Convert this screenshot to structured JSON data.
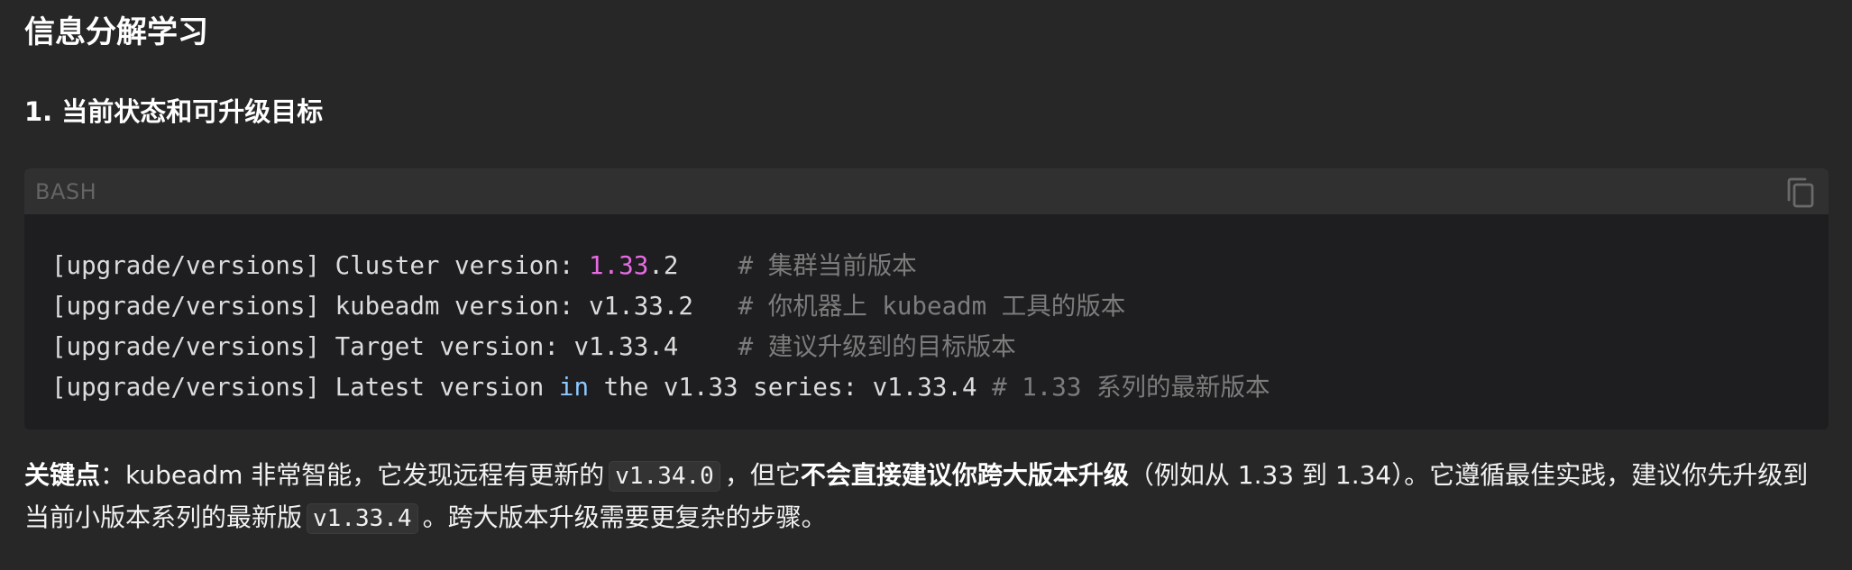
{
  "article": {
    "title": "信息分解学习",
    "section_heading": "1. 当前状态和可升级目标"
  },
  "code_block": {
    "language": "BASH",
    "copy_icon": "copy-icon",
    "lines": [
      {
        "prefix": "[upgrade/versions] Cluster version: ",
        "number": "1.33",
        "rest": ".2    ",
        "comment": "# 集群当前版本"
      },
      {
        "text": "[upgrade/versions] kubeadm version: v1.33.2   ",
        "comment": "# 你机器上 kubeadm 工具的版本"
      },
      {
        "text": "[upgrade/versions] Target version: v1.33.4    ",
        "comment": "# 建议升级到的目标版本"
      },
      {
        "prefix": "[upgrade/versions] Latest version ",
        "keyword": "in",
        "rest": " the v1.33 series: v1.33.4 ",
        "comment": "# 1.33 系列的最新版本"
      }
    ]
  },
  "paragraph": {
    "key_label": "关键点",
    "colon": "：",
    "t1": "kubeadm 非常智能，它发现远程有更新的",
    "code1": "v1.34.0",
    "t2": "，但它",
    "bold2": "不会直接建议你跨大版本升级",
    "t3": "（例如从 1.33 到 1.34）。它遵循最佳实践，建议你先升级到当前小版本系列的最新版",
    "code2": "v1.33.4",
    "t4": "。跨大版本升级需要更复杂的步骤。"
  },
  "colors": {
    "background": "#272727",
    "code_background": "#1e1e20",
    "code_header": "#303030",
    "number": "#e76be3",
    "keyword": "#8ec8ff",
    "comment": "#7c7c7c"
  }
}
